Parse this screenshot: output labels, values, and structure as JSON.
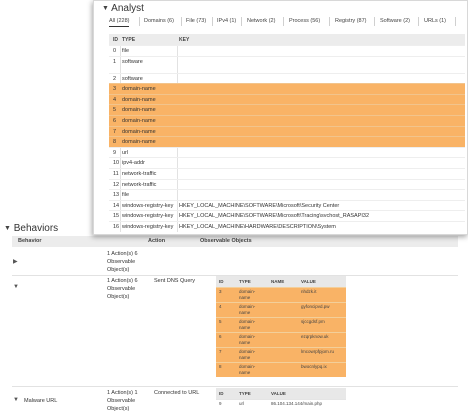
{
  "behaviors": {
    "title": "Behaviors",
    "columns": {
      "behavior": "Behavior",
      "action": "Action",
      "observable": "Observable Objects"
    },
    "rows": [
      {
        "name": "",
        "action": "1 Action(s) 6 Observable Object(s)",
        "desc": ""
      },
      {
        "name": "",
        "action": "1 Action(s) 6 Observable Object(s)",
        "desc": "Sent DNS Query"
      },
      {
        "name": "Malware URL",
        "action": "1 Action(s) 1 Observable Object(s)",
        "desc": "Connected to URL"
      }
    ],
    "dns_table": {
      "headers": [
        "ID",
        "TYPE",
        "NAME",
        "VALUE"
      ],
      "rows": [
        {
          "id": "3",
          "type": "domain-name",
          "name": "",
          "value": "nhdzk.it"
        },
        {
          "id": "4",
          "type": "domain-name",
          "name": "",
          "value": "gyfoncipvd.pw"
        },
        {
          "id": "5",
          "type": "domain-name",
          "name": "",
          "value": "sjccgdsf.pm"
        },
        {
          "id": "6",
          "type": "domain-name",
          "name": "",
          "value": "ezqrpknow.uk"
        },
        {
          "id": "7",
          "type": "domain-name",
          "name": "",
          "value": "lmcowrpfpjom.ru"
        },
        {
          "id": "8",
          "type": "domain-name",
          "name": "",
          "value": "bwocnlypq.ix"
        }
      ]
    },
    "url_table": {
      "headers": [
        "ID",
        "TYPE",
        "VALUE"
      ],
      "rows": [
        {
          "id": "9",
          "type": "url",
          "value": "86.104.134.144/main.php"
        }
      ]
    }
  },
  "analyst": {
    "title": "Analyst",
    "tabs": [
      "All (228)",
      "Domains (6)",
      "File (73)",
      "IPv4 (1)",
      "Network (2)",
      "Process (56)",
      "Registry (87)",
      "Software (2)",
      "URLs (1)"
    ],
    "columns": {
      "id": "ID",
      "type": "TYPE",
      "key": "KEY"
    },
    "rows": [
      {
        "id": "0",
        "type": "file",
        "key": ""
      },
      {
        "id": "1",
        "type": "software",
        "key": ""
      },
      {
        "id": "2",
        "type": "software",
        "key": ""
      },
      {
        "id": "3",
        "type": "domain-name",
        "key": ""
      },
      {
        "id": "4",
        "type": "domain-name",
        "key": ""
      },
      {
        "id": "5",
        "type": "domain-name",
        "key": ""
      },
      {
        "id": "6",
        "type": "domain-name",
        "key": ""
      },
      {
        "id": "7",
        "type": "domain-name",
        "key": ""
      },
      {
        "id": "8",
        "type": "domain-name",
        "key": ""
      },
      {
        "id": "9",
        "type": "url",
        "key": ""
      },
      {
        "id": "10",
        "type": "ipv4-addr",
        "key": ""
      },
      {
        "id": "11",
        "type": "network-traffic",
        "key": ""
      },
      {
        "id": "12",
        "type": "network-traffic",
        "key": ""
      },
      {
        "id": "13",
        "type": "file",
        "key": ""
      },
      {
        "id": "14",
        "type": "windows-registry-key",
        "key": "HKEY_LOCAL_MACHINE\\SOFTWARE\\Microsoft\\Security Center"
      },
      {
        "id": "15",
        "type": "windows-registry-key",
        "key": "HKEY_LOCAL_MACHINE\\SOFTWARE\\Microsoft\\Tracing\\svchost_RASAPI32"
      },
      {
        "id": "16",
        "type": "windows-registry-key",
        "key": "HKEY_LOCAL_MACHINE\\HARDWARE\\DESCRIPTION\\System"
      }
    ]
  },
  "colors": {
    "highlight": "#f9b366",
    "header": "#ececec"
  }
}
